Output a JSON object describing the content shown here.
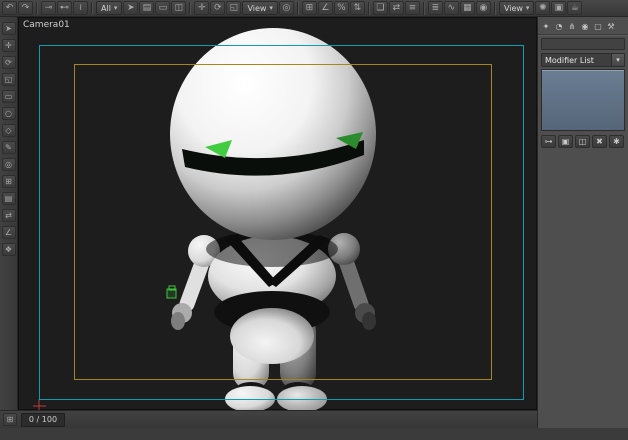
{
  "colors": {
    "safe_frame_cyan": "#129aad",
    "safe_frame_yellow": "#a3871a",
    "modifier_stack_blue": "#5d6f84",
    "viewport_bg": "#1d1d1d",
    "gizmo_green": "#3ec43e",
    "eye_green_bright": "#41cc41",
    "eye_green_dim": "#2b8c2d"
  },
  "top_toolbar": {
    "items": [
      {
        "name": "undo-icon",
        "glyph": "↶"
      },
      {
        "name": "redo-icon",
        "glyph": "↷"
      },
      {
        "type": "sep"
      },
      {
        "name": "select-and-link-icon",
        "glyph": "⊸"
      },
      {
        "name": "unlink-selection-icon",
        "glyph": "⊷"
      },
      {
        "name": "bind-to-spacewarp-icon",
        "glyph": "≀"
      },
      {
        "type": "sep"
      },
      {
        "type": "dropdown",
        "name": "selection-filter-dropdown",
        "label": "All"
      },
      {
        "name": "select-object-icon",
        "glyph": "➤"
      },
      {
        "name": "select-by-name-icon",
        "glyph": "▤"
      },
      {
        "name": "select-region-icon",
        "glyph": "▭"
      },
      {
        "name": "window-crossing-icon",
        "glyph": "◫"
      },
      {
        "type": "sep"
      },
      {
        "name": "select-and-move-icon",
        "glyph": "✛"
      },
      {
        "name": "select-and-rotate-icon",
        "glyph": "⟳"
      },
      {
        "name": "select-and-scale-icon",
        "glyph": "◱"
      },
      {
        "type": "dropdown",
        "name": "reference-coordinate-dropdown",
        "label": "View"
      },
      {
        "name": "use-pivot-center-icon",
        "glyph": "◎"
      },
      {
        "type": "sep"
      },
      {
        "name": "snap-toggle-icon",
        "glyph": "⊞"
      },
      {
        "name": "angle-snap-icon",
        "glyph": "∠"
      },
      {
        "name": "percent-snap-icon",
        "glyph": "%"
      },
      {
        "name": "spinner-snap-icon",
        "glyph": "⇅"
      },
      {
        "type": "sep"
      },
      {
        "name": "named-selection-sets-icon",
        "glyph": "❏"
      },
      {
        "name": "mirror-icon",
        "glyph": "⇄"
      },
      {
        "name": "align-icon",
        "glyph": "≡"
      },
      {
        "type": "sep"
      },
      {
        "name": "layer-manager-icon",
        "glyph": "≣"
      },
      {
        "name": "curve-editor-icon",
        "glyph": "∿"
      },
      {
        "name": "schematic-view-icon",
        "glyph": "▦"
      },
      {
        "name": "material-editor-icon",
        "glyph": "◉"
      },
      {
        "type": "sep"
      },
      {
        "type": "dropdown",
        "name": "viewport-layout-dropdown",
        "label": "View"
      },
      {
        "name": "render-setup-icon",
        "glyph": "✺"
      },
      {
        "name": "rendered-frame-window-icon",
        "glyph": "▣"
      },
      {
        "name": "render-production-icon",
        "glyph": "☕"
      }
    ]
  },
  "left_toolbar": {
    "items": [
      {
        "name": "select-tool-icon",
        "glyph": "➤"
      },
      {
        "name": "move-tool-icon",
        "glyph": "✛"
      },
      {
        "name": "rotate-tool-icon",
        "glyph": "⟳"
      },
      {
        "name": "scale-tool-icon",
        "glyph": "◱"
      },
      {
        "name": "rect-tool-icon",
        "glyph": "▭"
      },
      {
        "name": "circle-tool-icon",
        "glyph": "○"
      },
      {
        "name": "poly-tool-icon",
        "glyph": "◇"
      },
      {
        "name": "pen-tool-icon",
        "glyph": "✎"
      },
      {
        "name": "target-tool-icon",
        "glyph": "◎"
      },
      {
        "name": "grid-tool-icon",
        "glyph": "⊞"
      },
      {
        "name": "layers-tool-icon",
        "glyph": "▤"
      },
      {
        "name": "mirror-tool-icon",
        "glyph": "⇄"
      },
      {
        "name": "angle-tool-icon",
        "glyph": "∠"
      },
      {
        "name": "nav-tool-icon",
        "glyph": "❖"
      }
    ]
  },
  "viewport": {
    "label": "Camera01"
  },
  "right_panel": {
    "tabs": [
      {
        "name": "create-tab",
        "glyph": "✦"
      },
      {
        "name": "modify-tab",
        "glyph": "◔"
      },
      {
        "name": "hierarchy-tab",
        "glyph": "⋔"
      },
      {
        "name": "motion-tab",
        "glyph": "◉"
      },
      {
        "name": "display-tab",
        "glyph": "▢"
      },
      {
        "name": "utilities-tab",
        "glyph": "⚒"
      }
    ],
    "object_name_value": "",
    "modifier_list_label": "Modifier List",
    "stack_buttons": [
      {
        "name": "pin-stack-button",
        "glyph": "⊶"
      },
      {
        "name": "show-end-result-button",
        "glyph": "▣"
      },
      {
        "name": "make-unique-button",
        "glyph": "◫"
      },
      {
        "name": "remove-modifier-button",
        "glyph": "✖"
      },
      {
        "name": "configure-modifier-sets-button",
        "glyph": "✱"
      }
    ]
  },
  "status_bar": {
    "items": [
      {
        "name": "time-tag-icon",
        "glyph": "⊞"
      }
    ],
    "frame_display": "0 / 100"
  }
}
